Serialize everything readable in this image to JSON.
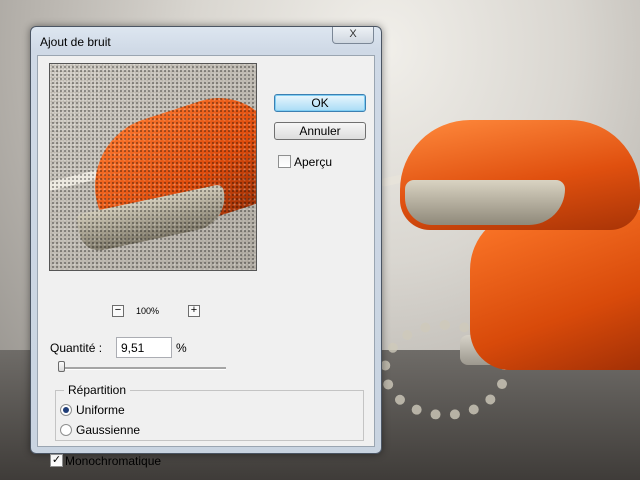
{
  "dialog": {
    "title": "Ajout de bruit",
    "close_label": "X"
  },
  "buttons": {
    "ok_label": "OK",
    "cancel_label": "Annuler"
  },
  "preview": {
    "checkbox_label": "Aperçu",
    "checked": false,
    "zoom_level": "100%",
    "zoom_out_label": "−",
    "zoom_in_label": "+"
  },
  "quantity": {
    "label": "Quantité :",
    "value": "9,51",
    "unit": "%",
    "slider_fraction": 0.02
  },
  "distribution": {
    "group_label": "Répartition",
    "options": [
      {
        "label": "Uniforme",
        "selected": true
      },
      {
        "label": "Gaussienne",
        "selected": false
      }
    ]
  },
  "monochrome": {
    "label": "Monochromatique",
    "checked": true,
    "check_glyph": "✓"
  },
  "colors": {
    "ok_button_border": "#3c7fb1",
    "selected_radio": "#1f3d78"
  }
}
